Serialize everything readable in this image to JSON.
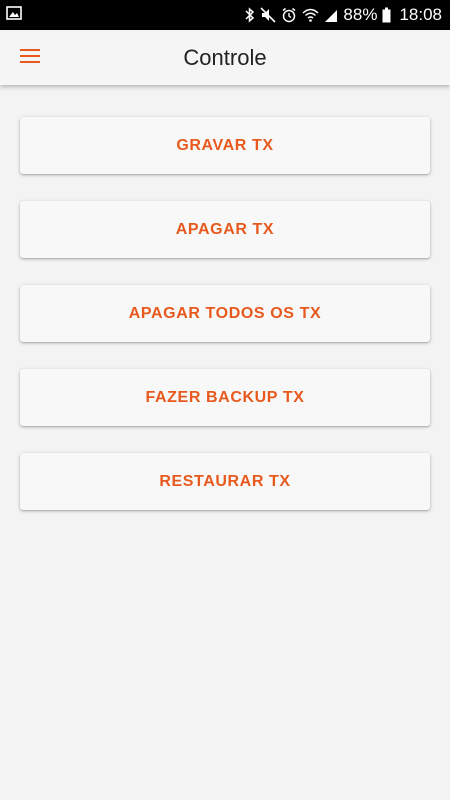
{
  "status_bar": {
    "battery_percent": "88%",
    "time": "18:08",
    "left_icons": [
      "gallery-icon"
    ],
    "right_icons": [
      "bluetooth-icon",
      "mute-icon",
      "alarm-icon",
      "wifi-icon",
      "signal-icon",
      "battery-icon"
    ]
  },
  "app_bar": {
    "title": "Controle",
    "menu_icon": "hamburger-menu-icon"
  },
  "actions": [
    {
      "label": "GRAVAR TX"
    },
    {
      "label": "APAGAR TX"
    },
    {
      "label": "APAGAR TODOS OS TX"
    },
    {
      "label": "FAZER BACKUP TX"
    },
    {
      "label": "RESTAURAR TX"
    }
  ],
  "colors": {
    "accent": "#e8591e",
    "background": "#f3f3f3",
    "button_background": "#f8f8f8",
    "status_bar": "#000000"
  }
}
